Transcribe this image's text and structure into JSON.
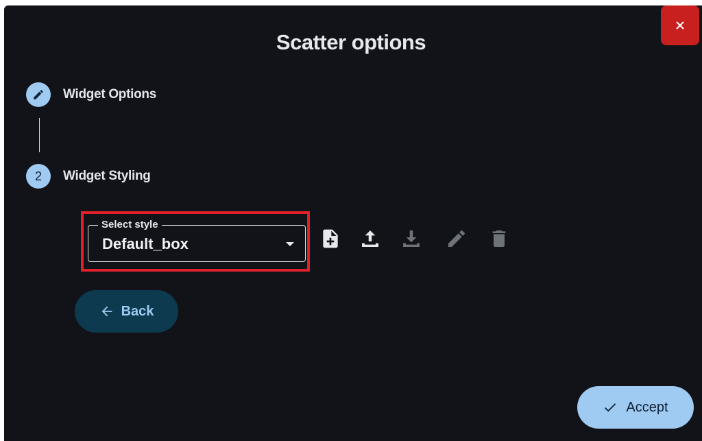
{
  "dialog": {
    "title": "Scatter options",
    "close_icon": "close-icon"
  },
  "stepper": {
    "steps": [
      {
        "badge": "",
        "icon": "pencil-icon",
        "label": "Widget Options",
        "state": "completed"
      },
      {
        "badge": "2",
        "label": "Widget Styling",
        "state": "active"
      }
    ]
  },
  "style_select": {
    "legend": "Select style",
    "value": "Default_box",
    "caret_icon": "chevron-down-icon"
  },
  "toolbar": {
    "icons": [
      {
        "name": "new-file-icon",
        "enabled": true
      },
      {
        "name": "upload-icon",
        "enabled": true
      },
      {
        "name": "download-icon",
        "enabled": false
      },
      {
        "name": "edit-icon",
        "enabled": false
      },
      {
        "name": "delete-icon",
        "enabled": false
      }
    ]
  },
  "buttons": {
    "back_label": "Back",
    "back_icon": "arrow-left-icon",
    "accept_label": "Accept",
    "accept_icon": "check-icon"
  },
  "colors": {
    "background": "#111318",
    "accent": "#9fcaf2",
    "close": "#c81f1f",
    "highlight": "#e0202a",
    "back_button": "#0d3a4f"
  }
}
